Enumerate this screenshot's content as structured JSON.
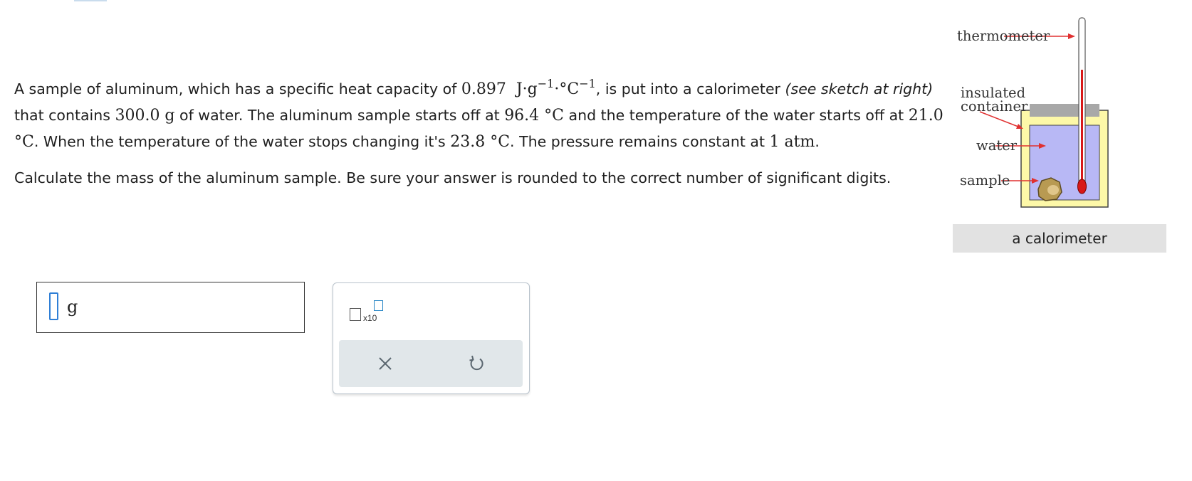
{
  "problem": {
    "p1_a": "A sample of aluminum, which has a specific heat capacity of ",
    "cp_value": "0.897",
    "cp_unit_J": "J·g",
    "cp_exp1": "−1",
    "cp_dot": "·°C",
    "cp_exp2": "−1",
    "p1_b": ", is put into a calorimeter ",
    "p1_italic": "(see sketch at right)",
    "p1_c": " that contains ",
    "water_mass": "300.0 g",
    "p1_d": " of water. The aluminum sample starts off at ",
    "t_aluminum": "96.4 °C",
    "p1_e": " and the temperature of the water starts off at ",
    "t_water_initial": "21.0 °C",
    "p1_f": ". When the temperature of the water stops changing it's ",
    "t_final": "23.8 °C",
    "p1_g": ". The pressure remains constant at ",
    "pressure": "1 atm",
    "p1_h": ".",
    "question": "Calculate the mass of the aluminum sample. Be sure your answer is rounded to the correct number of significant digits."
  },
  "figure": {
    "label_thermometer": "thermometer",
    "label_insulated": "insulated",
    "label_container": "container",
    "label_water": "water",
    "label_sample": "sample",
    "caption": "a calorimeter",
    "colors": {
      "water": "#b8b8f5",
      "container": "#fdf8a8",
      "lid": "#a8a8a8",
      "arrow": "#e03030",
      "bulb": "#d81818",
      "sample": "#b89a52"
    }
  },
  "answer": {
    "value": "",
    "unit": "g"
  },
  "tools": {
    "sci_notation_label": "x10",
    "clear_icon": "close-icon",
    "undo_icon": "undo-icon"
  }
}
